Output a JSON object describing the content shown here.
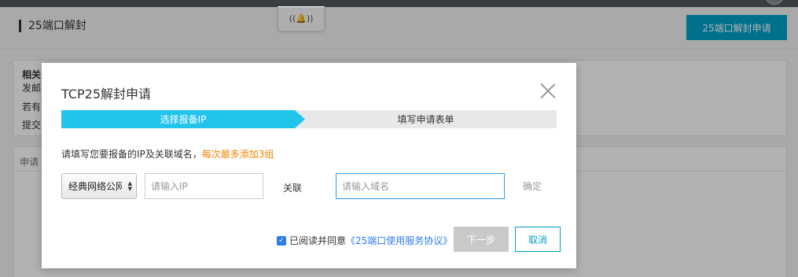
{
  "page": {
    "title": "25端口解封",
    "apply_button": "25端口解封申请",
    "bell_icon": "bell-icon"
  },
  "background": {
    "panel1_title": "相关",
    "panel1_lines": [
      "发邮",
      "若有",
      "提交"
    ],
    "panel2_title": "申请"
  },
  "modal": {
    "title": "TCP25解封申请",
    "steps": [
      {
        "label": "选择报备IP",
        "active": true
      },
      {
        "label": "填写申请表单",
        "active": false
      }
    ],
    "hint_text": "请填写您要报备的IP及关联域名，",
    "hint_warning": "每次最多添加3组",
    "network_select": "经典网络公网",
    "ip_placeholder": "请输入IP",
    "assoc_label": "关联",
    "domain_placeholder": "请输入域名",
    "confirm_label": "确定",
    "agree_text": "已阅读并同意",
    "agree_link": "《25端口使用服务协议》",
    "agree_checked": true,
    "next_label": "下一步",
    "cancel_label": "取消"
  },
  "colors": {
    "accent": "#00a2ca",
    "step_active": "#23c4ec",
    "warning": "#f68300",
    "link": "#2b7de9"
  }
}
